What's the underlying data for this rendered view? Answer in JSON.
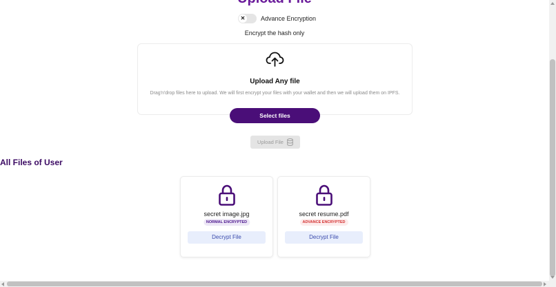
{
  "page": {
    "title": "Upload File"
  },
  "encryption": {
    "toggle_symbol": "✕",
    "toggle_label": "Advance Encryption",
    "note": "Encrypt the hash only"
  },
  "dropzone": {
    "icon": "cloud-upload-icon",
    "title": "Upload Any file",
    "description": "Drag'n'drop files here to upload. We will first encrypt your files with your wallet and then we will upload them on IPFS.",
    "select_button": "Select files"
  },
  "upload": {
    "button_label": "Upload File",
    "icon": "database-icon"
  },
  "files_section": {
    "title": "All Files of User",
    "files": [
      {
        "name": "secret image.jpg",
        "badge": "NORMAL ENCRYPTED",
        "action": "Decrypt File",
        "icon": "lock-icon"
      },
      {
        "name": "secret resume.pdf",
        "badge": "ADVANCE ENCRYPTED",
        "action": "Decrypt File",
        "icon": "lock-icon"
      }
    ]
  },
  "colors": {
    "primary": "#4a0e78",
    "title": "#6a1b9a",
    "normal_badge": "#4a148c",
    "advance_badge": "#d32f2f"
  }
}
